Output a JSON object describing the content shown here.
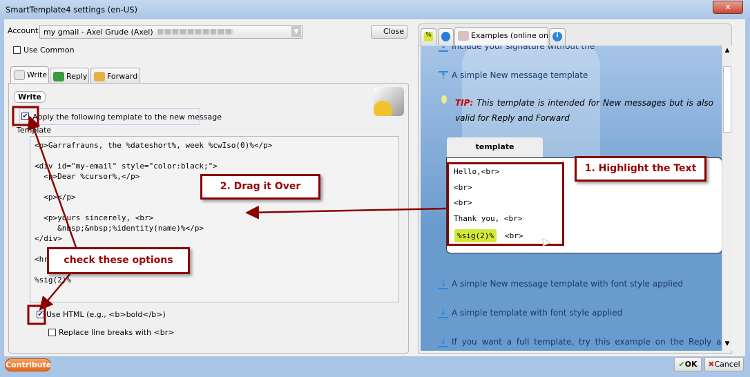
{
  "window": {
    "title": "SmartTemplate4 settings (en-US)",
    "close_glyph": "✕"
  },
  "account": {
    "label": "Account:",
    "value": "my gmail - Axel Grude (Axel)",
    "close_button": "Close"
  },
  "use_common": {
    "label": "Use Common",
    "checked": false
  },
  "tabs": [
    {
      "label": "Write",
      "active": true
    },
    {
      "label": "Reply"
    },
    {
      "label": "Forward"
    }
  ],
  "write_panel": {
    "heading": "Write",
    "apply_template": {
      "label": "Apply the following template to the new message",
      "checked": true
    },
    "template_label": "Template",
    "template_text": "<p>Garrafrauns, the %dateshort%, week %cwIso(0)%</p>\n\n<div id=\"my-email\" style=\"color:black;\">\n  <p>Dear %cursor%,</p>\n\n  <p></p>\n\n  <p>yours sincerely, <br>\n     &nbsp;&nbsp;%identity(name)%</p>\n</div>\n\n<hr>\n\n%sig(2)%",
    "use_html": {
      "label": "Use HTML (e.g., <b>bold</b>)",
      "checked": true
    },
    "replace_breaks": {
      "label": "Replace line breaks with <br>",
      "checked": false
    }
  },
  "right_tabs": [
    {
      "icon": "percent-icon"
    },
    {
      "icon": "gear-icon"
    },
    {
      "label": "Examples (online only)",
      "active": true
    },
    {
      "icon": "info-icon"
    }
  ],
  "examples": {
    "item_top": "Include your signature without the",
    "item_simple": "A simple New message template",
    "tip_label": "TIP:",
    "tip_text": "This template is intended for New messages but is also valid for Reply and Forward",
    "template_tab": "template",
    "template_lines": [
      "Hello,<br>",
      "<br>",
      "<br>",
      "Thank you, <br>"
    ],
    "sig_code": "%sig(2)%",
    "sig_after": "<br>",
    "item_font1": "A simple New message template with font style applied",
    "item_font2": "A simple template with font style applied",
    "item_full": "If you want a full template, try this example on the Reply and"
  },
  "annotations": {
    "step1": "1. Highlight the Text",
    "step2": "2. Drag it Over",
    "check": "check these options"
  },
  "footer": {
    "contribute": "Contribute",
    "ok": "OK",
    "cancel": "Cancel"
  },
  "colors": {
    "annotation": "#8b0000",
    "contribute": "#f07a2a",
    "examples_bg": "#6a9bcf",
    "sig_highlight": "#d4e83a"
  }
}
